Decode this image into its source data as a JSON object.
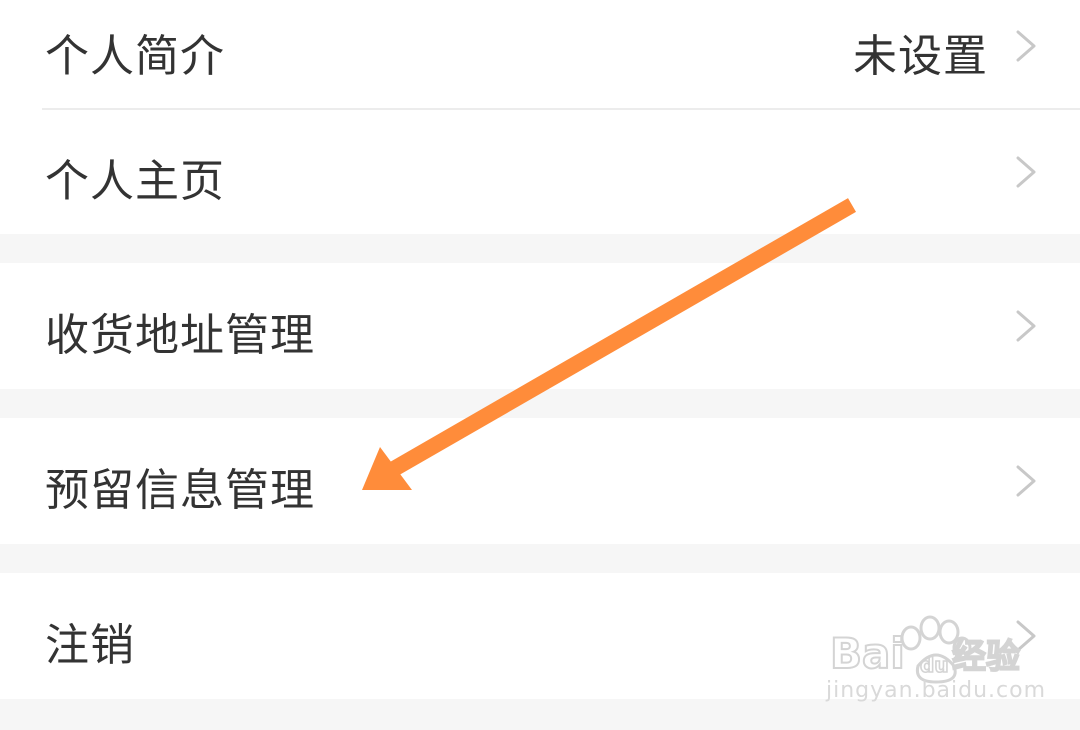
{
  "settings": {
    "items": [
      {
        "label": "个人简介",
        "value": "未设置"
      },
      {
        "label": "个人主页"
      },
      {
        "label": "收货地址管理"
      },
      {
        "label": "预留信息管理"
      },
      {
        "label": "注销"
      }
    ]
  },
  "annotation": {
    "arrow_color": "#ff8c3a",
    "points_to": "预留信息管理"
  },
  "watermark": {
    "brand": "Baidu经验",
    "url": "jingyan.baidu.com"
  },
  "colors": {
    "background": "#f6f6f6",
    "row": "#ffffff",
    "text": "#333333",
    "chevron": "#c8c8c8"
  }
}
